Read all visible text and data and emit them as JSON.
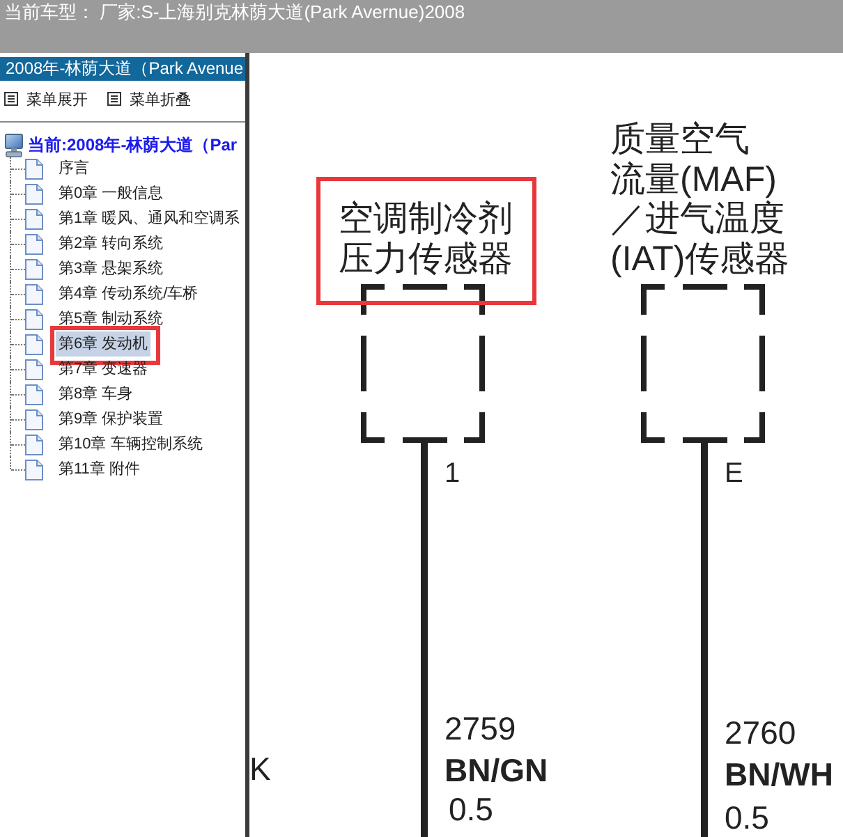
{
  "header": {
    "title": "当前车型： 厂家:S-上海别克林荫大道(Park Avernue)2008"
  },
  "sidebar": {
    "title": "2008年-林荫大道（Park Avenue",
    "menu_buttons": [
      "菜单展开",
      "菜单折叠"
    ],
    "tree": {
      "label": "当前:2008年-林荫大道（Par",
      "children": [
        {
          "label": "序言",
          "selected": false,
          "marked": false
        },
        {
          "label": "第0章 一般信息",
          "selected": false,
          "marked": false
        },
        {
          "label": "第1章 暖风、通风和空调系",
          "selected": false,
          "marked": false
        },
        {
          "label": "第2章 转向系统",
          "selected": false,
          "marked": false
        },
        {
          "label": "第3章 悬架系统",
          "selected": false,
          "marked": false
        },
        {
          "label": "第4章 传动系统/车桥",
          "selected": false,
          "marked": false
        },
        {
          "label": "第5章 制动系统",
          "selected": false,
          "marked": false
        },
        {
          "label": "第6章 发动机",
          "selected": true,
          "marked": true
        },
        {
          "label": "第7章 变速器",
          "selected": false,
          "marked": false
        },
        {
          "label": "第8章 车身",
          "selected": false,
          "marked": false
        },
        {
          "label": "第9章 保护装置",
          "selected": false,
          "marked": false
        },
        {
          "label": "第10章 车辆控制系统",
          "selected": false,
          "marked": false
        },
        {
          "label": "第11章 附件",
          "selected": false,
          "marked": false
        }
      ]
    }
  },
  "diagram": {
    "cut_label": "K",
    "sensors": [
      {
        "label_lines": [
          "空调制冷剂",
          "压力传感器"
        ],
        "marked": true,
        "pin": "1",
        "circuit": "2759",
        "color_code": "BN/GN",
        "wire_size": "0.5"
      },
      {
        "label_lines": [
          "质量空气",
          "流量(MAF)",
          "／进气温度",
          "(IAT)传感器"
        ],
        "marked": false,
        "pin": "E",
        "circuit": "2760",
        "color_code": "BN/WH",
        "wire_size": "0.5"
      }
    ]
  }
}
